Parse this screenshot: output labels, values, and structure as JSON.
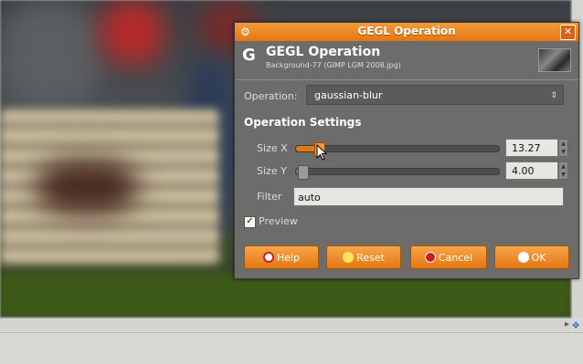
{
  "dialog": {
    "window_title": "GEGL Operation",
    "header_title": "GEGL Operation",
    "header_subtitle": "Background-77 (GIMP LGM 2008.jpg)",
    "operation_label": "Operation:",
    "operation_value": "gaussian-blur",
    "settings_heading": "Operation Settings",
    "size_x": {
      "label": "Size X",
      "value": "13.27",
      "level": 0.11
    },
    "size_y": {
      "label": "Size Y",
      "value": "4.00",
      "level": 0.03
    },
    "filter": {
      "label": "Filter",
      "value": "auto"
    },
    "preview": {
      "label": "Preview",
      "checked": true
    },
    "buttons": {
      "help": "Help",
      "reset": "Reset",
      "cancel": "Cancel",
      "ok": "OK"
    }
  },
  "colors": {
    "accent": "#e47812",
    "dialog_bg": "#6c6c6a"
  },
  "icons": [
    "gear-icon",
    "close-icon",
    "gegl-logo-icon",
    "help-icon",
    "reset-icon",
    "cancel-icon",
    "ok-icon",
    "chevron-spin-icon"
  ]
}
